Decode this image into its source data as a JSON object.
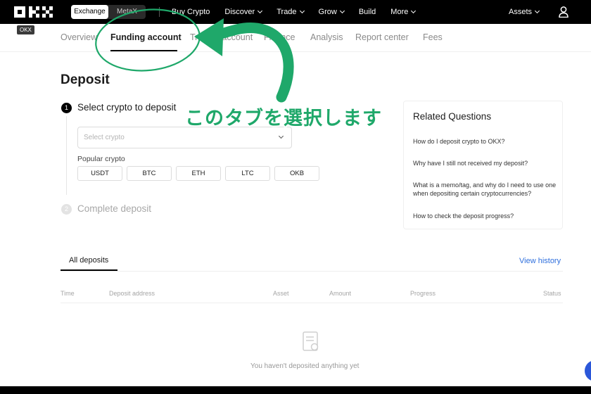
{
  "nav": {
    "toggle": [
      "Exchange",
      "MetaX"
    ],
    "menu": [
      {
        "label": "Buy Crypto",
        "dropdown": false
      },
      {
        "label": "Discover",
        "dropdown": true
      },
      {
        "label": "Trade",
        "dropdown": true
      },
      {
        "label": "Grow",
        "dropdown": true
      },
      {
        "label": "Build",
        "dropdown": false
      },
      {
        "label": "More",
        "dropdown": true
      }
    ],
    "assets_label": "Assets",
    "badge": "OKX"
  },
  "subtabs": [
    "Overview",
    "Funding account",
    "Trading account",
    "Finance",
    "Analysis",
    "Report center",
    "Fees"
  ],
  "page": {
    "title": "Deposit",
    "step1_number": "1",
    "step1_label": "Select crypto to deposit",
    "select_placeholder": "Select crypto",
    "popular_label": "Popular crypto",
    "popular": [
      "USDT",
      "BTC",
      "ETH",
      "LTC",
      "OKB"
    ],
    "step2_number": "2",
    "step2_label": "Complete deposit"
  },
  "related": {
    "title": "Related Questions",
    "questions": [
      "How do I deposit crypto to OKX?",
      "Why have I still not received my deposit?",
      "What is a memo/tag, and why do I need to use one when depositing certain cryptocurrencies?",
      "How to check the deposit progress?"
    ]
  },
  "deposits": {
    "tab": "All deposits",
    "view_history": "View history",
    "columns": [
      "Time",
      "Deposit address",
      "Asset",
      "Amount",
      "Progress",
      "Status"
    ],
    "empty": "You haven't deposited anything yet"
  },
  "annotation": {
    "text": "このタブを選択します",
    "color": "#1fa86a"
  }
}
